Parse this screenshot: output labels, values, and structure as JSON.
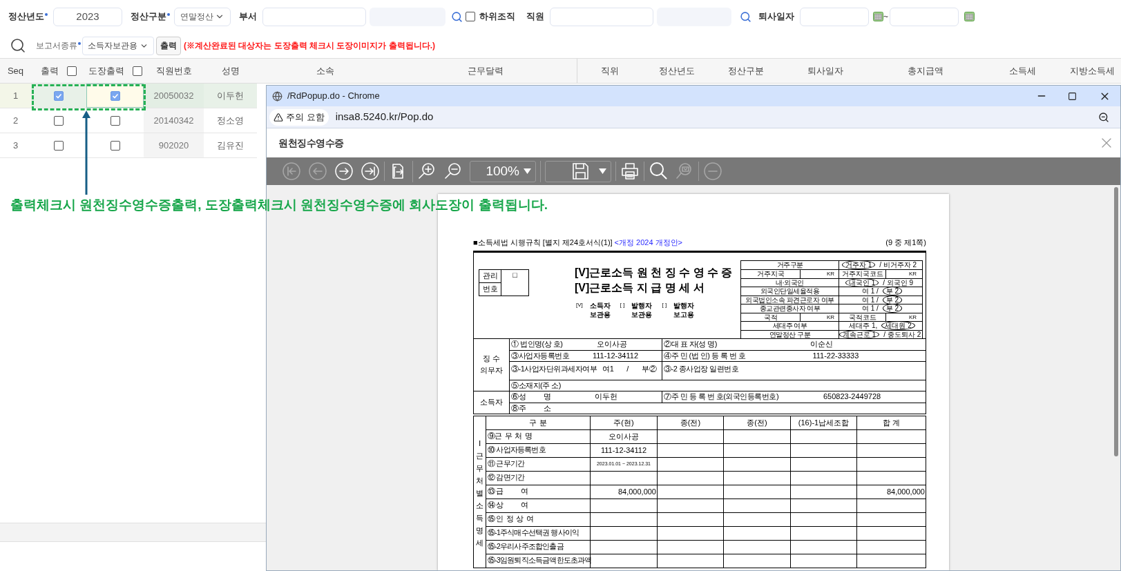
{
  "filters": {
    "year": {
      "label": "정산년도",
      "required": true,
      "value": "2023"
    },
    "settle_type": {
      "label": "정산구분",
      "required": true,
      "value": "연말정산"
    },
    "department": {
      "label": "부서"
    },
    "sub_org": {
      "label": "하위조직",
      "checked": false
    },
    "employee": {
      "label": "직원"
    },
    "retire_date": {
      "label": "퇴사일자",
      "separator": "~"
    }
  },
  "report": {
    "label": "보고서종류",
    "required": true,
    "value": "소득자보관용",
    "button": "출력",
    "notice": "(※계산완료된 대상자는 도장출력 체크시 도장이미지가 출력됩니다.)"
  },
  "table": {
    "columns": [
      {
        "label": "Seq",
        "kind": "text"
      },
      {
        "label": "출력",
        "kind": "checkbox",
        "checked": false
      },
      {
        "label": "도장출력",
        "kind": "checkbox",
        "checked": false
      },
      {
        "label": "직원번호",
        "kind": "text"
      },
      {
        "label": "성명",
        "kind": "text"
      },
      {
        "label": "소속",
        "kind": "text"
      },
      {
        "label": "근무달력",
        "kind": "text"
      },
      {
        "label": "직위",
        "kind": "text"
      },
      {
        "label": "정산년도",
        "kind": "text"
      },
      {
        "label": "정산구분",
        "kind": "text"
      },
      {
        "label": "퇴사일자",
        "kind": "text"
      },
      {
        "label": "총지급액",
        "kind": "text"
      },
      {
        "label": "소득세",
        "kind": "text"
      },
      {
        "label": "지방소득세",
        "kind": "text"
      }
    ],
    "rows": [
      {
        "seq": "1",
        "print": true,
        "stamp": true,
        "employee_no": "20050032",
        "name": "이두헌",
        "selected": true
      },
      {
        "seq": "2",
        "print": false,
        "stamp": false,
        "employee_no": "20140342",
        "name": "정소영",
        "selected": false
      },
      {
        "seq": "3",
        "print": false,
        "stamp": false,
        "employee_no": "902020",
        "name": "김유진",
        "selected": false
      }
    ]
  },
  "annotation": {
    "text": "출력체크시 원천징수영수증출력, 도장출력체크시 원천징수영수증에 회사도장이 출력됩니다."
  },
  "popup": {
    "title": "/RdPopup.do - Chrome",
    "warning": "주의 요함",
    "url": "insa8.5240.kr/Pop.do",
    "page_title": "원천징수영수증",
    "toolbar": [
      [
        {
          "kind": "first",
          "disabled": true
        },
        {
          "kind": "prev",
          "disabled": true
        },
        {
          "kind": "next",
          "disabled": false
        },
        {
          "kind": "last",
          "disabled": false
        }
      ],
      [
        {
          "kind": "export",
          "disabled": false
        }
      ],
      [
        {
          "kind": "zoom_in",
          "disabled": false
        },
        {
          "kind": "zoom_out",
          "disabled": false
        },
        {
          "kind": "zoom_select",
          "value": "100%"
        }
      ],
      [
        {
          "kind": "save_select",
          "disabled": false
        }
      ],
      [
        {
          "kind": "print",
          "disabled": false
        }
      ],
      [
        {
          "kind": "find",
          "disabled": false
        },
        {
          "kind": "find_next",
          "disabled": true
        }
      ],
      [
        {
          "kind": "remove",
          "disabled": true
        }
      ]
    ],
    "document": {
      "form_title": "■소득세법 시행규칙 [별지 제24호서식(1)]",
      "revision": "<개정 2024 개정안>",
      "page_info": "(9 중 제1쪽)",
      "management": {
        "label": [
          "관리",
          "번호"
        ],
        "box": "□"
      },
      "titles": [
        "[V]근로소득 원 천 징 수 영 수 증",
        "[V]근로소득 지 급 명 세 서"
      ],
      "copies": [
        {
          "mark": "[V]",
          "label": [
            "소득자",
            "보관용"
          ]
        },
        {
          "mark": "[ ]",
          "label": [
            "발행자",
            "보관용"
          ]
        },
        {
          "mark": "[ ]",
          "label": [
            "발행자",
            "보고용"
          ]
        }
      ],
      "residency": [
        {
          "kind": "choice",
          "label": "거주구분",
          "parts": [
            {
              "text": "거주자 1",
              "circled": true
            },
            {
              "text": "/ 비거주자 2",
              "circled": false
            }
          ]
        },
        {
          "kind": "pair",
          "label": "거주지국",
          "value": "KR",
          "label2": "거주지국코드",
          "value2": "KR"
        },
        {
          "kind": "choice",
          "label": "내·외국인",
          "parts": [
            {
              "text": "내국인 1",
              "circled": true
            },
            {
              "text": "/ 외국인 9",
              "circled": false
            }
          ]
        },
        {
          "kind": "choice",
          "label": "외국인단일세율적용",
          "parts": [
            {
              "text": "여 1 /",
              "circled": false
            },
            {
              "text": "부 2",
              "circled": true
            }
          ]
        },
        {
          "kind": "choice",
          "label": "외국법인소속 파견근로자 여부",
          "parts": [
            {
              "text": "여 1 /",
              "circled": false
            },
            {
              "text": "부 2",
              "circled": true
            }
          ]
        },
        {
          "kind": "choice",
          "label": "종교관련종사자 여부",
          "parts": [
            {
              "text": "여 1 /",
              "circled": false
            },
            {
              "text": "부 2",
              "circled": true
            }
          ]
        },
        {
          "kind": "pair",
          "label": "국적",
          "value": "KR",
          "label2": "국적코드",
          "value2": "KR"
        },
        {
          "kind": "choice",
          "label": "세대주 여부",
          "parts": [
            {
              "text": "세대주 1,",
              "circled": false
            },
            {
              "text": "세대원 2",
              "circled": true
            }
          ]
        },
        {
          "kind": "choice",
          "label": "연말정산 구분",
          "parts": [
            {
              "text": "계속근로 1",
              "circled": true
            },
            {
              "text": "/ 중도퇴사 2",
              "circled": false
            }
          ]
        }
      ],
      "withholder": {
        "label": [
          "징 수",
          "의무자"
        ],
        "rows": [
          [
            {
              "label": "① 법인명(상 호)",
              "value": "오이사공"
            },
            {
              "label": "②대 표 자(성 명)",
              "value": "이순신"
            }
          ],
          [
            {
              "label": "③사업자등록번호",
              "value": "111-12-34112"
            },
            {
              "label": "④주 민 (법 인) 등 록 번 호",
              "value": "111-22-33333"
            }
          ],
          [
            {
              "label": "③-1사업자단위과세자여부",
              "value": "여1      /      부②"
            },
            {
              "label": "③-2 종사업장 일련번호"
            }
          ],
          [
            {
              "label": "⑤소재지(주 소)"
            }
          ]
        ]
      },
      "recipient": {
        "label": "소득자",
        "rows": [
          [
            {
              "label": "⑥성          명",
              "value": "이두헌"
            },
            {
              "label": "⑦주 민 등 록 번 호(외국인등록번호)",
              "value": "650823-2449728"
            }
          ],
          [
            {
              "label": "⑧주          소"
            }
          ]
        ]
      },
      "income": {
        "side_label": "Ⅰ근무처별소득명세",
        "columns": [
          "구 분",
          "주(현)",
          "종(전)",
          "종(전)",
          "(16)-1납세조합",
          "합 계"
        ],
        "rows": [
          {
            "label": "⑨근  무  처  명",
            "kind": "text",
            "current": "오이사공"
          },
          {
            "label": "⑩ 사업자등록번호",
            "kind": "text",
            "current": "111-12-34112"
          },
          {
            "label": "⑪ 근무기간",
            "kind": "period",
            "current": "2023.01.01 ~ 2023.12.31"
          },
          {
            "label": "⑫ 감면기간",
            "kind": "text"
          },
          {
            "label": "⑬ 급            여",
            "kind": "amount",
            "current": "84,000,000",
            "total": "84,000,000"
          },
          {
            "label": "⑭ 상            여",
            "kind": "amount"
          },
          {
            "label": "⑮ 인  정  상  여",
            "kind": "amount"
          },
          {
            "label": "⑮-1주식매수선택권 행사이익",
            "kind": "amount"
          },
          {
            "label": "⑮-2우리사주조합인출금",
            "kind": "amount"
          },
          {
            "label": "⑮-3임원퇴직소득금액한도초과액",
            "kind": "amount"
          }
        ]
      }
    }
  }
}
